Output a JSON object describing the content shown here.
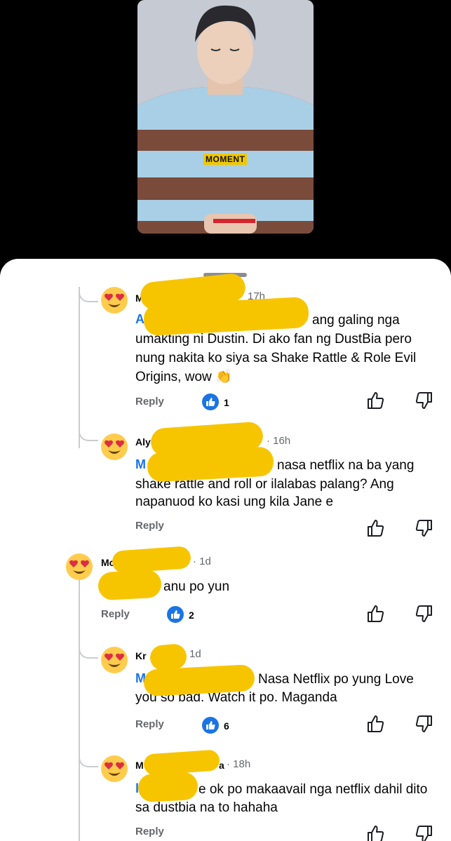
{
  "video": {
    "badge": "MOMENT"
  },
  "comments": [
    {
      "name": "M",
      "time": "17h",
      "mention": "A",
      "lines": [
        "ang galing nga",
        "umakting ni Dustin. Di ako fan ng DustBia pero",
        "nung nakita ko siya sa Shake Rattle & Role Evil",
        "Origins, wow 👏"
      ],
      "reply": "Reply",
      "likes": "1"
    },
    {
      "name": "Aly",
      "time": "· 16h",
      "mention": "M",
      "lines": [
        "nasa netflix na ba yang",
        "shake rattle and roll or ilalabas palang? Ang",
        "napanuod ko kasi ung kila Jane e"
      ],
      "reply": "Reply"
    },
    {
      "name": "Mc",
      "time": "· 1d",
      "lines": [
        "anu po yun"
      ],
      "reply": "Reply",
      "likes": "2"
    },
    {
      "name": "Kr",
      "time": "1d",
      "mention": "M",
      "lines": [
        "Nasa Netflix po yung Love",
        "you so bad. Watch it po. Maganda"
      ],
      "reply": "Reply",
      "likes": "6"
    },
    {
      "name": "M",
      "name_tail": "a",
      "time": "· 18h",
      "mention": "l",
      "lines": [
        "e ok po makaavail nga netflix dahil dito",
        "sa dustbia na to hahaha"
      ],
      "reply": "Reply"
    }
  ]
}
